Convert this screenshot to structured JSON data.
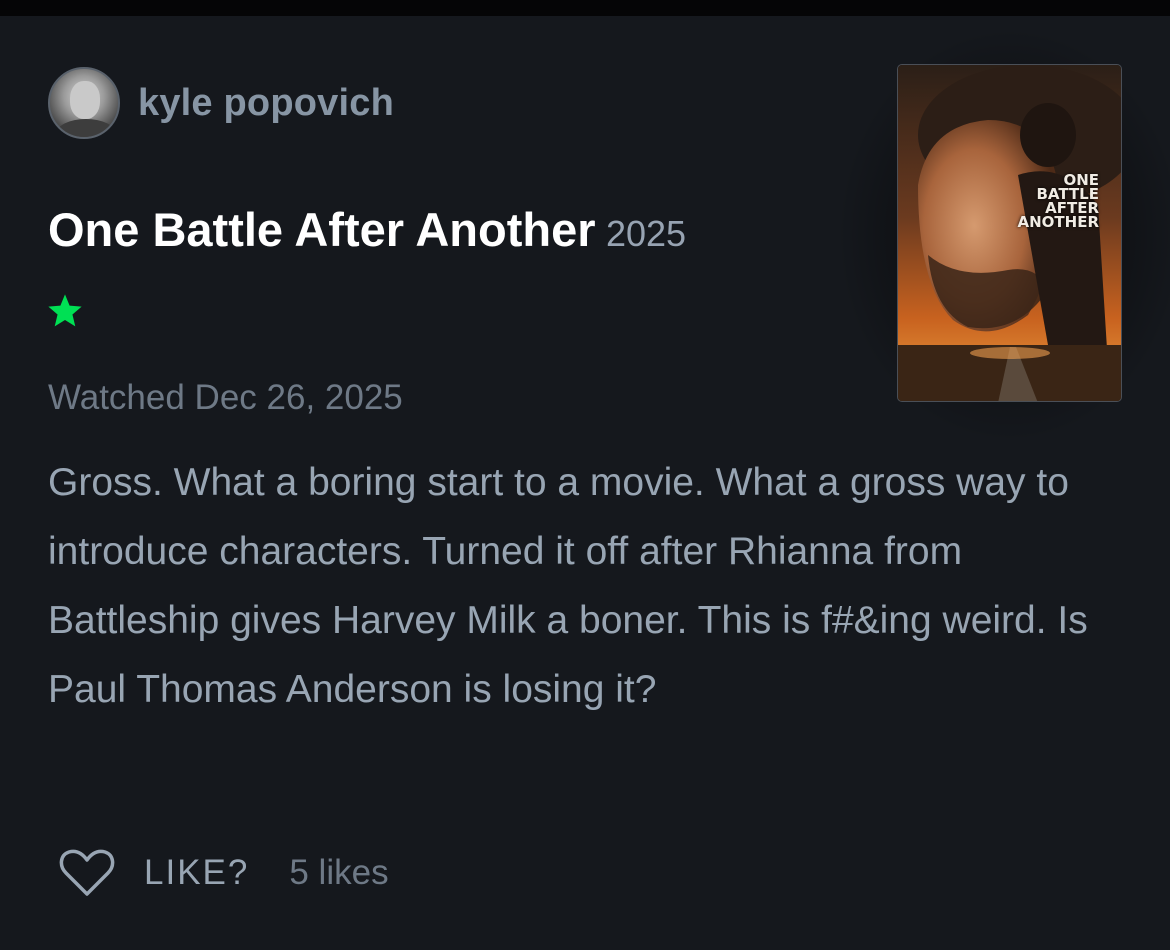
{
  "reviewer": {
    "name": "kyle popovich"
  },
  "film": {
    "title": "One Battle After Another",
    "year": "2025"
  },
  "poster": {
    "lines": [
      "ONE",
      "BATTLE",
      "AFTER",
      "ANOTHER"
    ]
  },
  "rating": {
    "stars": 1,
    "icon": "star-icon",
    "color": "#00e054"
  },
  "watched": "Watched Dec 26, 2025",
  "review": {
    "text": "Gross. What a boring start to a movie. What a gross way to introduce characters. Turned it off after Rhianna from Battleship gives Harvey Milk a boner. This is f#&ing weird. Is Paul Thomas Anderson is losing it?"
  },
  "actions": {
    "like_label": "LIKE?",
    "likes_count": "5 likes",
    "like_icon": "heart-icon"
  }
}
